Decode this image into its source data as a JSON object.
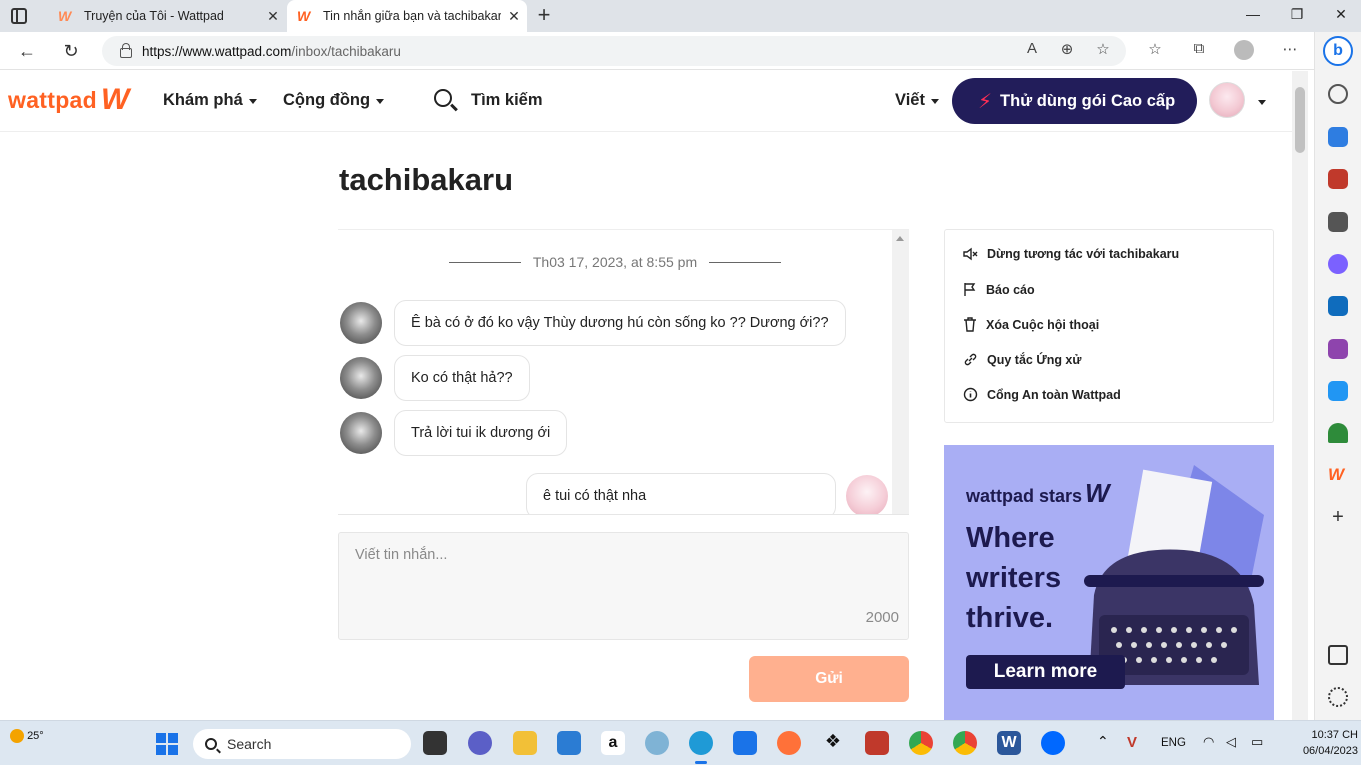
{
  "browser": {
    "tabs": [
      {
        "title": "Truyện của Tôi - Wattpad",
        "active": false
      },
      {
        "title": "Tin nhắn giữa bạn và tachibakaru",
        "active": true
      }
    ],
    "url_host": "https://www.wattpad.com",
    "url_path": "/inbox/tachibakaru"
  },
  "header": {
    "logo_text": "wattpad",
    "nav_explore": "Khám phá",
    "nav_community": "Cộng đồng",
    "search_label": "Tìm kiếm",
    "write_label": "Viết",
    "premium_label": "Thử dùng gói Cao cấp"
  },
  "conversation": {
    "title": "tachibakaru",
    "date": "Th03 17, 2023, at 8:55 pm",
    "messages": [
      {
        "text": "Ê bà có ở đó ko vậy Thùy dương  hú còn sống ko ?? Dương ới??",
        "mine": false
      },
      {
        "text": "Ko có thật hả??",
        "mine": false
      },
      {
        "text": "Trả lời tui ik dương ới",
        "mine": false
      },
      {
        "text": "ê tui có thật nha",
        "mine": true
      }
    ],
    "composer_placeholder": "Viết tin nhắn...",
    "char_limit": "2000",
    "send_label": "Gửi"
  },
  "options": {
    "mute": "Dừng tương tác với tachibakaru",
    "report": "Báo cáo",
    "delete": "Xóa Cuộc hội thoại",
    "conduct": "Quy tắc Ứng xử",
    "safety": "Cổng An toàn Wattpad"
  },
  "ad": {
    "brand": "wattpad stars",
    "headline_1": "Where",
    "headline_2": "writers",
    "headline_3": "thrive.",
    "cta": "Learn more"
  },
  "taskbar": {
    "temperature": "25°",
    "search_label": "Search",
    "language": "ENG",
    "time": "10:37 CH",
    "date": "06/04/2023"
  },
  "colors": {
    "brand": "#ff6122",
    "premium_bg": "#221d5a",
    "send_disabled": "#ffb08f",
    "ad_bg": "#a9aef4"
  }
}
